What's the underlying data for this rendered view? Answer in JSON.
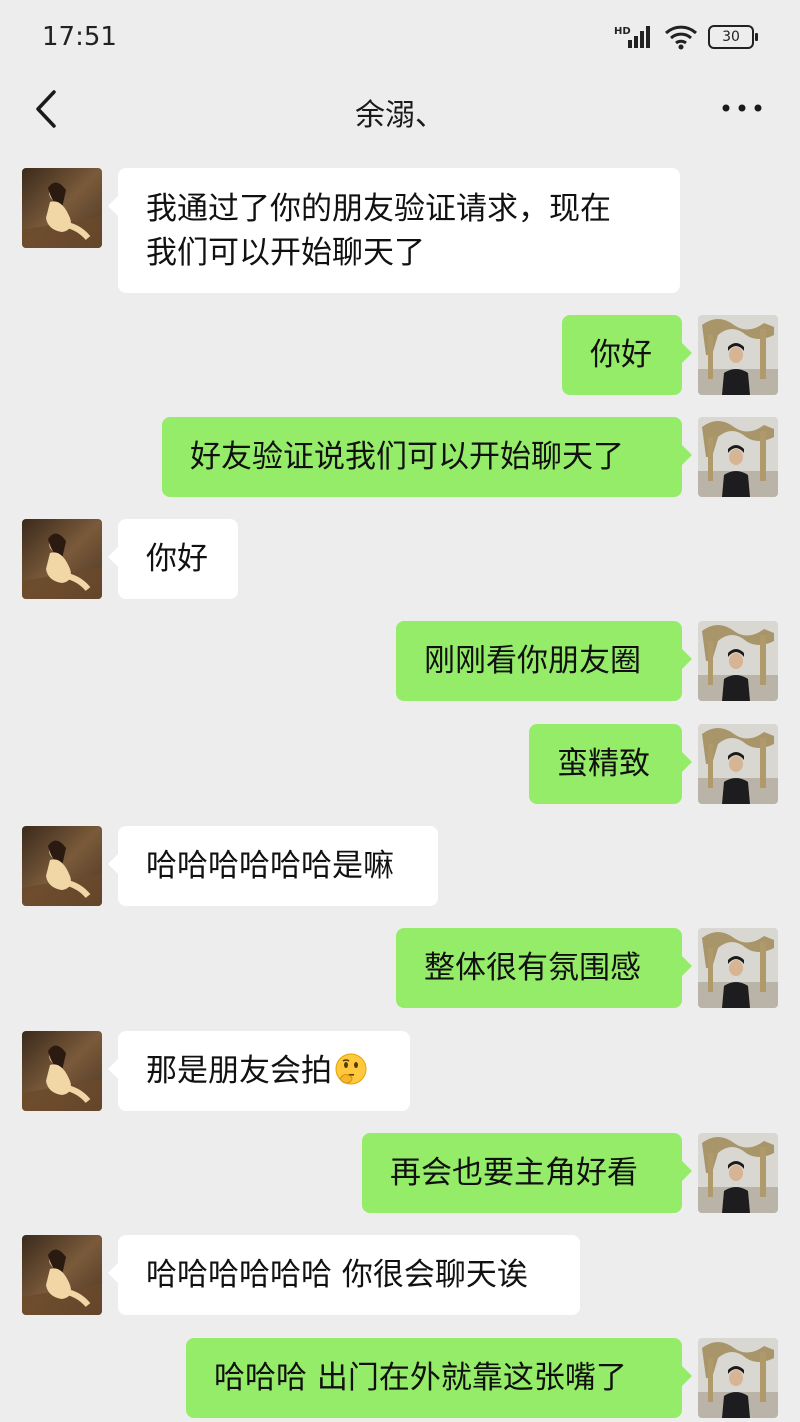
{
  "status_bar": {
    "time": "17:51",
    "network": "HD",
    "battery": "30"
  },
  "nav": {
    "title": "余溺、"
  },
  "messages": [
    {
      "side": "in",
      "text": "我通过了你的朋友验证请求，现在",
      "text2": "我们可以开始聊天了"
    },
    {
      "side": "out",
      "text": "你好"
    },
    {
      "side": "out",
      "text": "好友验证说我们可以开始聊天了"
    },
    {
      "side": "in",
      "text": "你好"
    },
    {
      "side": "out",
      "text": "刚刚看你朋友圈"
    },
    {
      "side": "out",
      "text": "蛮精致"
    },
    {
      "side": "in",
      "text": "哈哈哈哈哈哈是嘛"
    },
    {
      "side": "out",
      "text": "整体很有氛围感"
    },
    {
      "side": "in",
      "text": "那是朋友会拍",
      "emoji": "thinking-face-emoji"
    },
    {
      "side": "out",
      "text": "再会也要主角好看"
    },
    {
      "side": "in",
      "text": "哈哈哈哈哈哈 你很会聊天诶"
    },
    {
      "side": "out",
      "text": "哈哈哈 出门在外就靠这张嘴了"
    }
  ],
  "colors": {
    "background": "#ededed",
    "outgoing_bubble": "#95ec69",
    "incoming_bubble": "#ffffff"
  },
  "icons": {
    "back": "chevron-left-icon",
    "more": "more-dots-icon",
    "signal": "signal-icon",
    "wifi": "wifi-icon",
    "battery": "battery-icon"
  }
}
